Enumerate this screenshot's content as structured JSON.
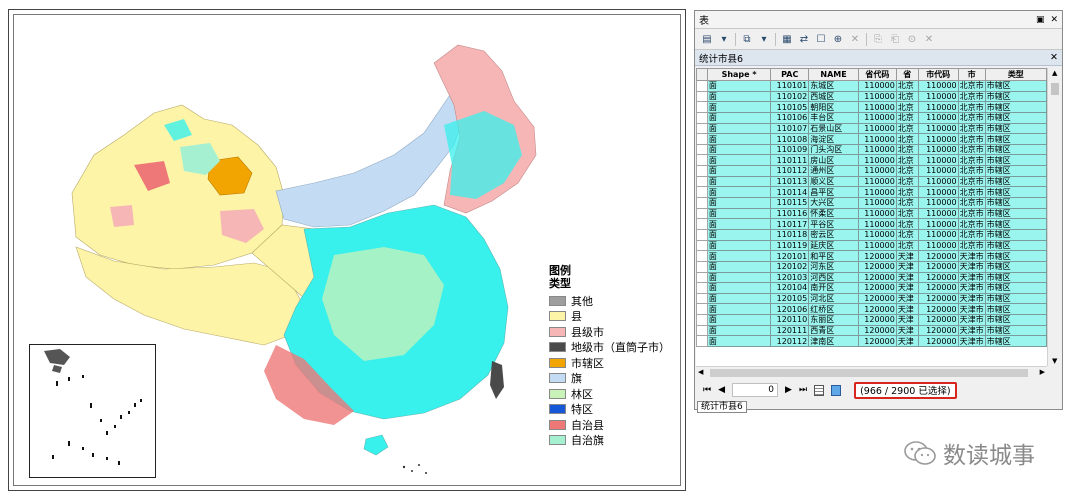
{
  "legend": {
    "title": "图例",
    "subtitle": "类型",
    "items": [
      {
        "label": "其他",
        "color": "#9e9e9e"
      },
      {
        "label": "县",
        "color": "#fdf4a8"
      },
      {
        "label": "县级市",
        "color": "#f6b6b6"
      },
      {
        "label": "地级市（直筒子市）",
        "color": "#4a4a4a"
      },
      {
        "label": "市辖区",
        "color": "#f2a500"
      },
      {
        "label": "旗",
        "color": "#c3dcf4"
      },
      {
        "label": "林区",
        "color": "#c9f2b8"
      },
      {
        "label": "特区",
        "color": "#1657d8"
      },
      {
        "label": "自治县",
        "color": "#ee7878"
      },
      {
        "label": "自治旗",
        "color": "#a6f0d2"
      }
    ],
    "selection_color": "#38f0ec"
  },
  "table_window": {
    "title": "表",
    "tab_header": "统计市县6",
    "close": "✕",
    "pin": "▣",
    "columns": [
      "",
      "Shape *",
      "PAC",
      "NAME",
      "省代码",
      "省",
      "市代码",
      "市",
      "类型"
    ],
    "rows": [
      [
        "面",
        "110101",
        "东城区",
        "110000",
        "北京",
        "110000",
        "北京市",
        "市辖区"
      ],
      [
        "面",
        "110102",
        "西城区",
        "110000",
        "北京",
        "110000",
        "北京市",
        "市辖区"
      ],
      [
        "面",
        "110105",
        "朝阳区",
        "110000",
        "北京",
        "110000",
        "北京市",
        "市辖区"
      ],
      [
        "面",
        "110106",
        "丰台区",
        "110000",
        "北京",
        "110000",
        "北京市",
        "市辖区"
      ],
      [
        "面",
        "110107",
        "石景山区",
        "110000",
        "北京",
        "110000",
        "北京市",
        "市辖区"
      ],
      [
        "面",
        "110108",
        "海淀区",
        "110000",
        "北京",
        "110000",
        "北京市",
        "市辖区"
      ],
      [
        "面",
        "110109",
        "门头沟区",
        "110000",
        "北京",
        "110000",
        "北京市",
        "市辖区"
      ],
      [
        "面",
        "110111",
        "房山区",
        "110000",
        "北京",
        "110000",
        "北京市",
        "市辖区"
      ],
      [
        "面",
        "110112",
        "通州区",
        "110000",
        "北京",
        "110000",
        "北京市",
        "市辖区"
      ],
      [
        "面",
        "110113",
        "顺义区",
        "110000",
        "北京",
        "110000",
        "北京市",
        "市辖区"
      ],
      [
        "面",
        "110114",
        "昌平区",
        "110000",
        "北京",
        "110000",
        "北京市",
        "市辖区"
      ],
      [
        "面",
        "110115",
        "大兴区",
        "110000",
        "北京",
        "110000",
        "北京市",
        "市辖区"
      ],
      [
        "面",
        "110116",
        "怀柔区",
        "110000",
        "北京",
        "110000",
        "北京市",
        "市辖区"
      ],
      [
        "面",
        "110117",
        "平谷区",
        "110000",
        "北京",
        "110000",
        "北京市",
        "市辖区"
      ],
      [
        "面",
        "110118",
        "密云区",
        "110000",
        "北京",
        "110000",
        "北京市",
        "市辖区"
      ],
      [
        "面",
        "110119",
        "延庆区",
        "110000",
        "北京",
        "110000",
        "北京市",
        "市辖区"
      ],
      [
        "面",
        "120101",
        "和平区",
        "120000",
        "天津",
        "120000",
        "天津市",
        "市辖区"
      ],
      [
        "面",
        "120102",
        "河东区",
        "120000",
        "天津",
        "120000",
        "天津市",
        "市辖区"
      ],
      [
        "面",
        "120103",
        "河西区",
        "120000",
        "天津",
        "120000",
        "天津市",
        "市辖区"
      ],
      [
        "面",
        "120104",
        "南开区",
        "120000",
        "天津",
        "120000",
        "天津市",
        "市辖区"
      ],
      [
        "面",
        "120105",
        "河北区",
        "120000",
        "天津",
        "120000",
        "天津市",
        "市辖区"
      ],
      [
        "面",
        "120106",
        "红桥区",
        "120000",
        "天津",
        "120000",
        "天津市",
        "市辖区"
      ],
      [
        "面",
        "120110",
        "东丽区",
        "120000",
        "天津",
        "120000",
        "天津市",
        "市辖区"
      ],
      [
        "面",
        "120111",
        "西青区",
        "120000",
        "天津",
        "120000",
        "天津市",
        "市辖区"
      ],
      [
        "面",
        "120112",
        "津南区",
        "120000",
        "天津",
        "120000",
        "天津市",
        "市辖区"
      ]
    ],
    "nav": {
      "first": "⏮",
      "prev": "◀",
      "record": "0",
      "next": "▶",
      "last": "⏭",
      "status": "(966 / 2900 已选择)"
    },
    "bottom_tab": "统计市县6"
  },
  "watermark": {
    "text": "数读城事"
  }
}
